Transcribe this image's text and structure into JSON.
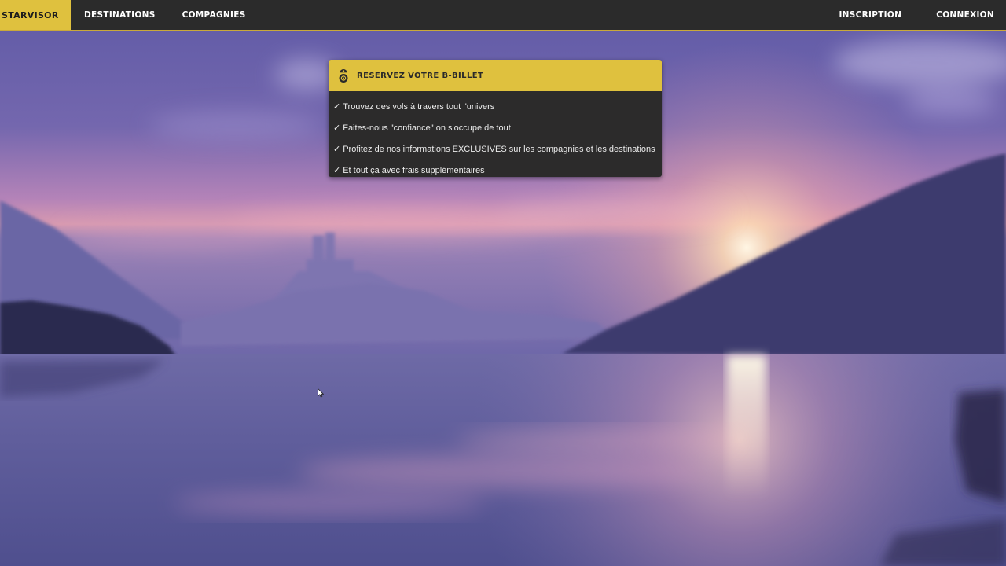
{
  "navbar": {
    "brand": "Starvisor",
    "left_items": [
      "Destinations",
      "Compagnies"
    ],
    "right_items": [
      "Inscription",
      "Connexion"
    ]
  },
  "booking_panel": {
    "icon": "droid-icon",
    "title": "Reservez votre B-Billet",
    "check_glyph": "✓",
    "items": [
      "Trouvez des vols à travers tout l'univers",
      "Faites-nous \"confiance\" on s'occupe de tout",
      "Profitez de nos informations EXCLUSIVES sur les compagnies et les destinations",
      "Et tout ça avec frais supplémentaires"
    ]
  },
  "colors": {
    "accent": "#dfc13e",
    "navbar_bg": "#2b2b2b",
    "panel_bg": "#2c2b2b"
  }
}
